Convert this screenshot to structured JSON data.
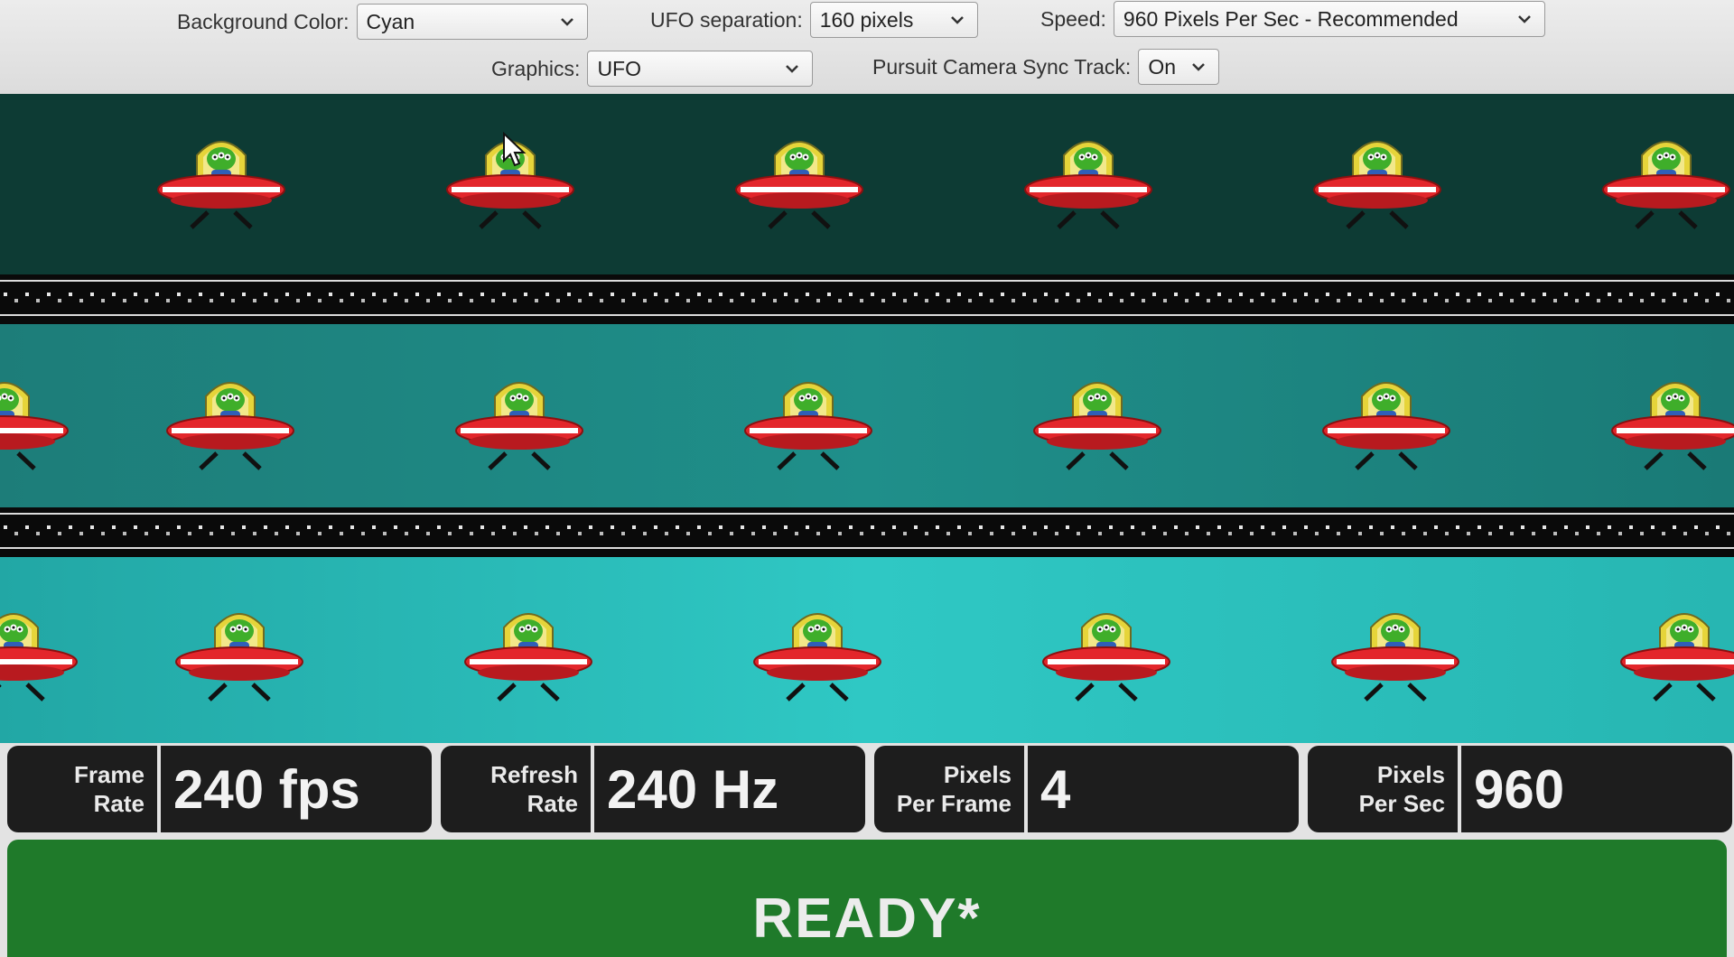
{
  "controls": {
    "background_color": {
      "label": "Background Color:",
      "value": "Cyan"
    },
    "ufo_separation": {
      "label": "UFO separation:",
      "value": "160 pixels"
    },
    "speed": {
      "label": "Speed:",
      "value": "960 Pixels Per Sec - Recommended"
    },
    "graphics": {
      "label": "Graphics:",
      "value": "UFO"
    },
    "pursuit_sync": {
      "label": "Pursuit Camera Sync Track:",
      "value": "On"
    }
  },
  "stats": {
    "frame_rate": {
      "label_1": "Frame",
      "label_2": "Rate",
      "value": "240 fps"
    },
    "refresh_rate": {
      "label_1": "Refresh",
      "label_2": "Rate",
      "value": "240 Hz"
    },
    "pixels_per_frame": {
      "label_1": "Pixels",
      "label_2": "Per Frame",
      "value": "4"
    },
    "pixels_per_sec": {
      "label_1": "Pixels",
      "label_2": "Per Sec",
      "value": "960"
    }
  },
  "status": "READY*",
  "colors": {
    "track_dark": "#0d3b34",
    "track_mid": "#1f8f8a",
    "track_light": "#2fc8c4",
    "ufo_saucer": "#e3262b",
    "alien": "#3fae2a",
    "ready_bg": "#1f7a2a"
  }
}
